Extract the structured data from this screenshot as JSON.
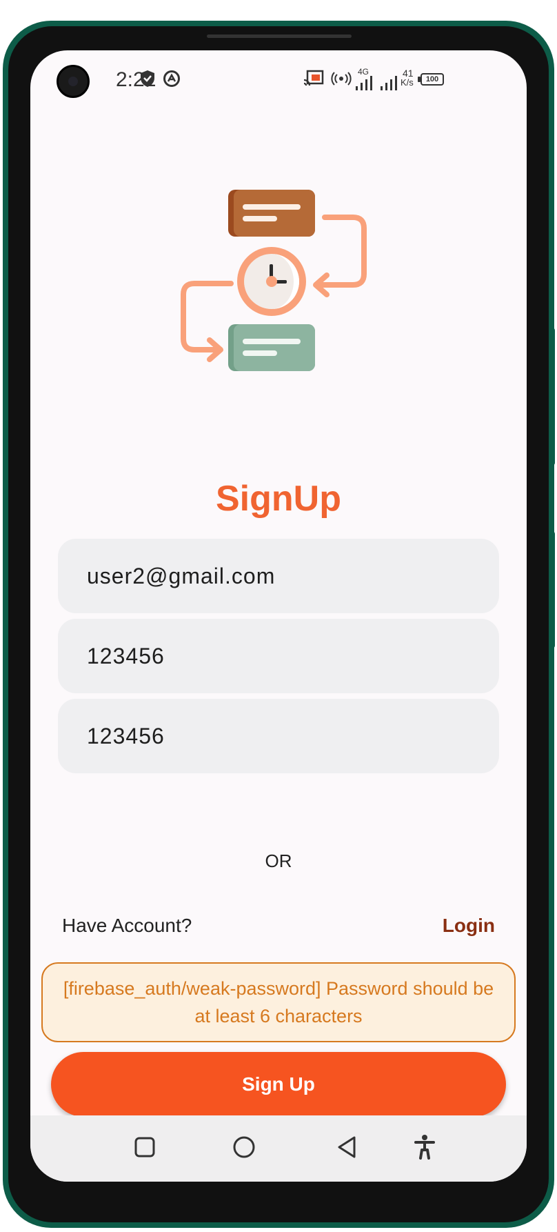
{
  "status_bar": {
    "time": "2:21",
    "network_label": "4G",
    "speed_value": "41",
    "speed_unit": "K/s",
    "battery": "100",
    "icons": [
      "shield-icon",
      "vpn-icon",
      "cast-icon",
      "hotspot-icon",
      "signal-icon",
      "battery-icon"
    ]
  },
  "page": {
    "title": "SignUp"
  },
  "form": {
    "email_value": "user2@gmail.com",
    "password_value": "123456",
    "confirm_password_value": "123456"
  },
  "divider_text": "OR",
  "account": {
    "prompt": "Have Account?",
    "login_label": "Login"
  },
  "error_toast": {
    "message": "[firebase_auth/weak-password] Password should be at least 6 characters"
  },
  "signup_button": {
    "label": "Sign Up"
  },
  "nav": {
    "items": [
      "recents-icon",
      "home-icon",
      "back-icon",
      "accessibility-icon"
    ]
  },
  "colors": {
    "accent": "#f06431",
    "button": "#f65420",
    "login_link": "#8a2f12",
    "toast_text": "#d6791f",
    "toast_bg": "#fdf0de",
    "frame": "#0d5c48"
  }
}
